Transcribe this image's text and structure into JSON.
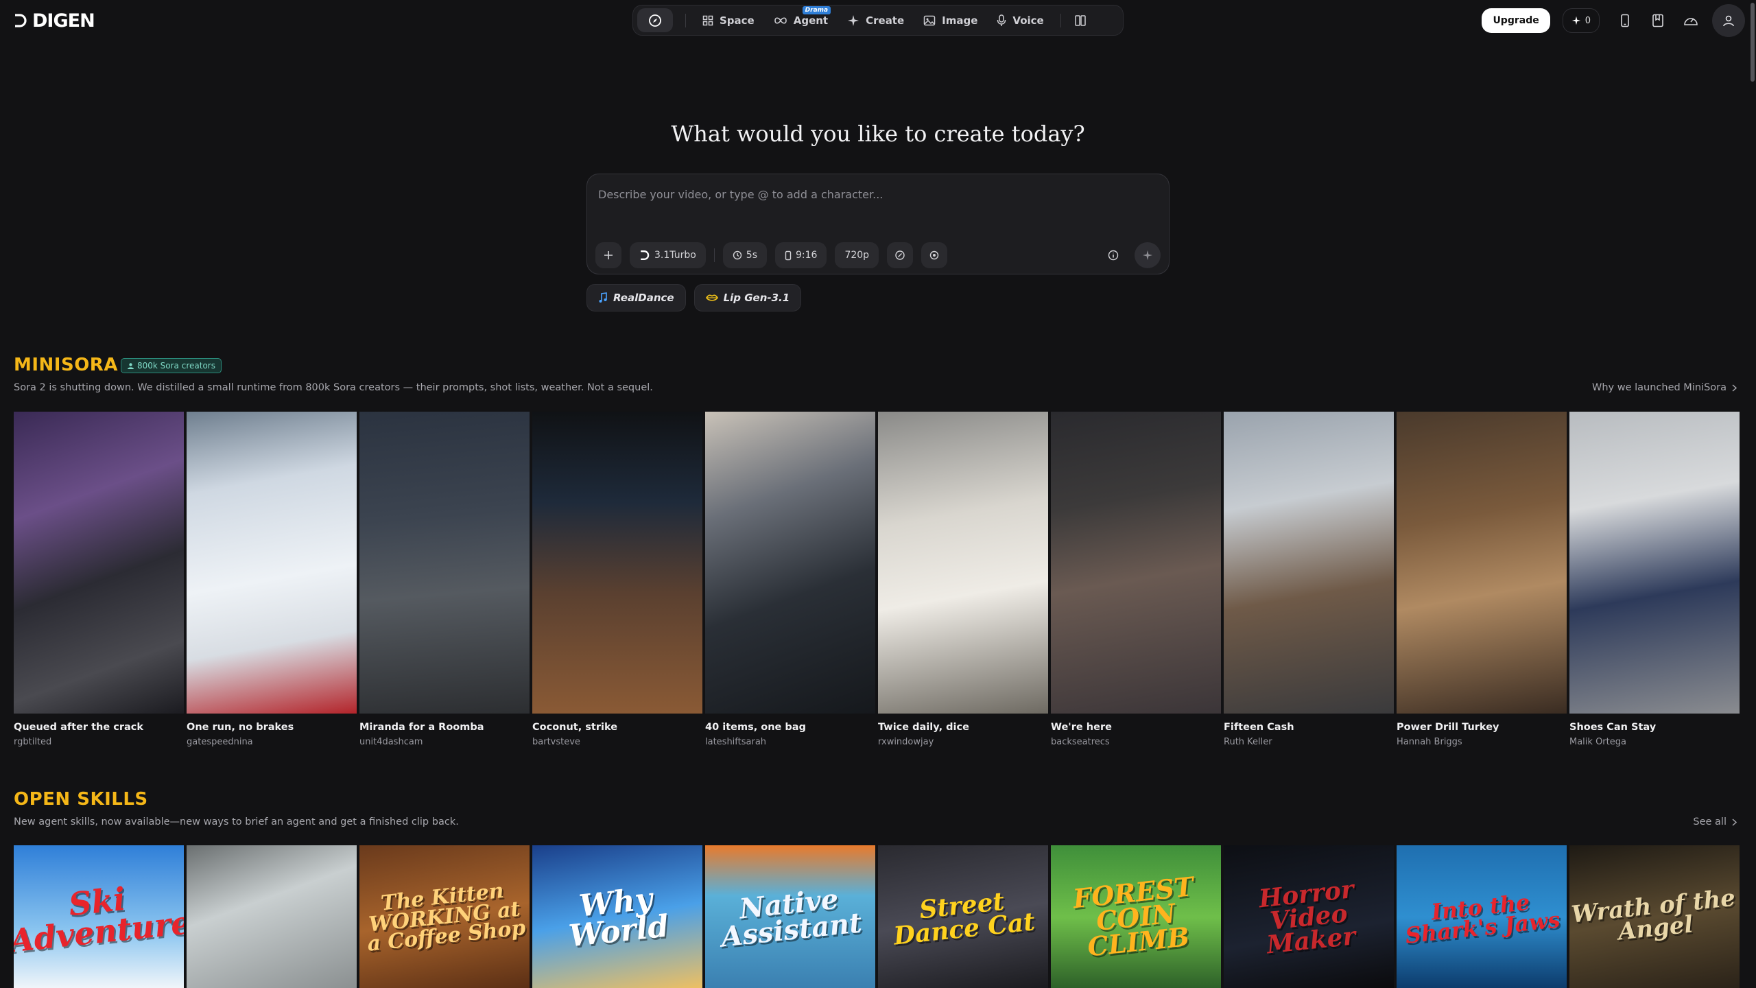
{
  "brand": {
    "name": "DIGEN"
  },
  "nav": {
    "items": [
      {
        "label": "Space",
        "icon": "grid-icon"
      },
      {
        "label": "Agent",
        "icon": "infinity-icon",
        "badge": "Drama"
      },
      {
        "label": "Create",
        "icon": "sparkle-icon"
      },
      {
        "label": "Image",
        "icon": "image-icon"
      },
      {
        "label": "Voice",
        "icon": "microphone-icon"
      }
    ]
  },
  "header": {
    "upgrade_label": "Upgrade",
    "credits": "0"
  },
  "hero": {
    "title": "What would you like to create today?",
    "placeholder": "Describe your video, or type @ to add a character...",
    "model": "3.1Turbo",
    "duration": "5s",
    "aspect": "9:16",
    "resolution": "720p"
  },
  "chips": [
    {
      "label": "RealDance",
      "icon": "music-note-icon",
      "color": "#4aa3ff"
    },
    {
      "label": "Lip Gen-3.1",
      "icon": "lips-icon",
      "color": "#f5c518"
    }
  ],
  "minisora": {
    "title": "MINISORA",
    "badge": "800k Sora creators",
    "subtitle": "Sora 2 is shutting down. We distilled a small runtime from 800k Sora creators — their prompts, shot lists, weather. Not a sequel.",
    "link": "Why we launched MiniSora",
    "cards": [
      {
        "title": "Queued after the crack",
        "author": "rgbtilted",
        "bg": "linear-gradient(160deg,#3a2a55 0%,#6b4f88 30%,#2b2b33 55%,#4a4a50 80%,#1b1b20 100%)"
      },
      {
        "title": "One run, no brakes",
        "author": "gatespeednina",
        "bg": "linear-gradient(170deg,#6f7f8f 0%,#cfd8e2 25%,#eef2f6 55%,#d8dde3 75%,#b3242a 100%)"
      },
      {
        "title": "Miranda for a Roomba",
        "author": "unit4dashcam",
        "bg": "linear-gradient(175deg,#2b3340 0%,#3c4450 35%,#555a60 60%,#2c2e31 100%)"
      },
      {
        "title": "Coconut, strike",
        "author": "bartvsteve",
        "bg": "linear-gradient(180deg,#101215 0%,#1e2a3a 30%,#5a4030 60%,#8a5a35 100%)"
      },
      {
        "title": "40 items, one bag",
        "author": "lateshiftsarah",
        "bg": "linear-gradient(160deg,#c9c2b8 0%,#6a6f78 30%,#2a2f36 60%,#15181c 100%)"
      },
      {
        "title": "Twice daily, dice",
        "author": "rxwindowjay",
        "bg": "linear-gradient(170deg,#8a8a88 0%,#d9d6cf 35%,#efece6 60%,#6e6a62 100%)"
      },
      {
        "title": "We're here",
        "author": "backseatrecs",
        "bg": "linear-gradient(170deg,#2a2a2e 0%,#3c3a3a 30%,#6a5a52 55%,#3b3538 100%)"
      },
      {
        "title": "Fifteen Cash",
        "author": "Ruth Keller",
        "bg": "linear-gradient(170deg,#9aa3ad 0%,#c7ccd1 30%,#6f5a48 60%,#3a3a3c 100%)"
      },
      {
        "title": "Power Drill Turkey",
        "author": "Hannah Briggs",
        "bg": "linear-gradient(170deg,#4a3a2c 0%,#7a5a3c 35%,#b08a62 60%,#3a2c22 100%)"
      },
      {
        "title": "Shoes Can Stay",
        "author": "Malik Ortega",
        "bg": "linear-gradient(170deg,#b8bcc0 0%,#d8dadc 30%,#2d3a5a 60%,#8a8c90 100%)"
      }
    ]
  },
  "skills": {
    "title": "OPEN SKILLS",
    "subtitle": "New agent skills, now available—new ways to brief an agent and get a finished clip back.",
    "link": "See all",
    "cards": [
      {
        "text": "Ski Adventure",
        "bg": "linear-gradient(180deg,#2f7fd8 0%,#8cc6f0 60%,#f2f6fa 100%)",
        "color": "#e8242c",
        "size": 46
      },
      {
        "text": "",
        "bg": "linear-gradient(160deg,#6a6f70 0%,#c9cfd0 40%,#8a8f90 100%)",
        "color": "#fff",
        "size": 20
      },
      {
        "text": "The Kitten WORKING at a Coffee Shop",
        "bg": "linear-gradient(170deg,#6a3a1c 0%,#a8642c 50%,#5a2e14 100%)",
        "color": "#ffd27a",
        "size": 30
      },
      {
        "text": "Why World",
        "bg": "linear-gradient(170deg,#1a3f8a 0%,#4aa0e8 50%,#f0c060 100%)",
        "color": "#ffffff",
        "size": 44
      },
      {
        "text": "Native Assistant",
        "bg": "linear-gradient(180deg,#e87a2c 0%,#5ab0d8 35%,#3a7fb0 100%)",
        "color": "#f2f7ff",
        "size": 40
      },
      {
        "text": "Street Dance Cat",
        "bg": "linear-gradient(170deg,#2a2a30 0%,#4a4a55 50%,#1a1a1e 100%)",
        "color": "#ffd21e",
        "size": 36
      },
      {
        "text": "FOREST COIN CLIMB",
        "bg": "linear-gradient(180deg,#3f8f3a 0%,#6fbf4a 50%,#2c5f28 100%)",
        "color": "#ffb41e",
        "size": 38
      },
      {
        "text": "Horror Video Maker",
        "bg": "linear-gradient(170deg,#0d0f14 0%,#1c2230 60%,#0a0a0c 100%)",
        "color": "#c8282c",
        "size": 36
      },
      {
        "text": "Into the Shark's Jaws",
        "bg": "linear-gradient(180deg,#1f6fb0 0%,#2f8fd0 50%,#0c3a6a 100%)",
        "color": "#e8242c",
        "size": 32
      },
      {
        "text": "Wrath of the Angel",
        "bg": "linear-gradient(170deg,#1e1a14 0%,#5a4a30 50%,#2a2218 100%)",
        "color": "#e8d6a8",
        "size": 34
      }
    ]
  }
}
